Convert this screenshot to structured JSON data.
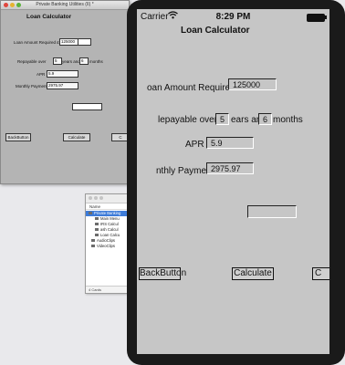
{
  "background_window": {
    "title": "Private Banking Utilities (II) *",
    "heading": "Loan Calculator",
    "loan_label": "Loan Amount Required  £",
    "loan_value": "125000",
    "repay_label": "Repayable over",
    "years_value": "5",
    "years_label": "years and",
    "months_value": "6",
    "months_label": "months",
    "apr_label": "APR",
    "apr_value": "5.9",
    "payment_label": "Monthly Payment",
    "payment_value": "2975.97",
    "back_button": "BackButton",
    "calculate_button": "Calculate",
    "third_button": "C"
  },
  "outline_window": {
    "column_header": "Name",
    "rows": [
      "Private Banking",
      "Main Menu",
      "IRS Calcul",
      "ash Calcul",
      "Loan Calcu",
      "AudioClips",
      "VideoClips"
    ],
    "footer": "4 Cards"
  },
  "phone": {
    "status": {
      "carrier": "Carrier",
      "wifi_icon": "wifi-icon",
      "time": "8:29 PM"
    },
    "title": "Loan Calculator",
    "loan_label": "oan Amount Required  £",
    "loan_value": "125000",
    "repay_label": "lepayable over",
    "years_value": "5",
    "years_label": "ears and",
    "months_value": "6",
    "months_label": "months",
    "apr_label": "APR",
    "apr_value": "5.9",
    "payment_label": "nthly Payment",
    "payment_value": "2975.97",
    "empty_field_value": "",
    "back_button": "BackButton",
    "calculate_button": "Calculate",
    "third_button": "C"
  }
}
